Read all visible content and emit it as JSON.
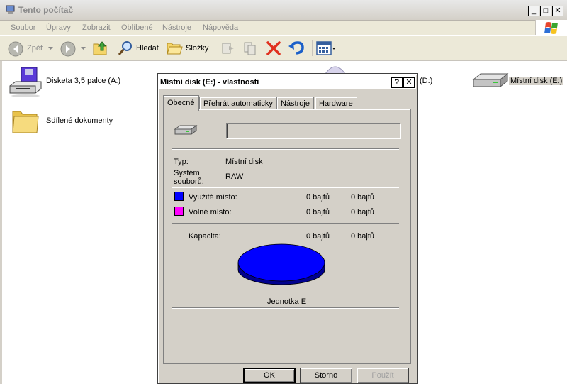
{
  "window": {
    "title": "Tento počítač",
    "controls": {
      "minimize": "_",
      "maximize": "□",
      "close": "✕"
    }
  },
  "menu": [
    "Soubor",
    "Úpravy",
    "Zobrazit",
    "Oblíbené",
    "Nástroje",
    "Nápověda"
  ],
  "toolbar": {
    "back_label": "Zpět",
    "search_label": "Hledat",
    "folders_label": "Složky"
  },
  "items": {
    "floppy": "Disketa 3,5 palce (A:)",
    "shared_docs": "Sdílené dokumenty",
    "cd_drive": "(D:)",
    "local_disk": "Místní disk (E:)"
  },
  "dialog": {
    "title": "Místní disk (E:) - vlastnosti",
    "help_btn": "?",
    "close_btn": "✕",
    "tabs": [
      "Obecné",
      "Přehrát automaticky",
      "Nástroje",
      "Hardware"
    ],
    "active_tab": "Obecné",
    "name_value": "",
    "type_label": "Typ:",
    "type_value": "Místní disk",
    "fs_label_1": "Systém",
    "fs_label_2": "souborů:",
    "fs_value": "RAW",
    "used_label": "Využité místo:",
    "used_bytes": "0 bajtů",
    "used_size": "0 bajtů",
    "free_label": "Volné místo:",
    "free_bytes": "0 bajtů",
    "free_size": "0 bajtů",
    "capacity_label": "Kapacita:",
    "capacity_bytes": "0 bajtů",
    "capacity_size": "0 bajtů",
    "drive_label": "Jednotka E",
    "colors": {
      "used": "#0000ff",
      "free": "#ff00ff"
    },
    "buttons": {
      "ok": "OK",
      "cancel": "Storno",
      "apply": "Použít"
    }
  }
}
